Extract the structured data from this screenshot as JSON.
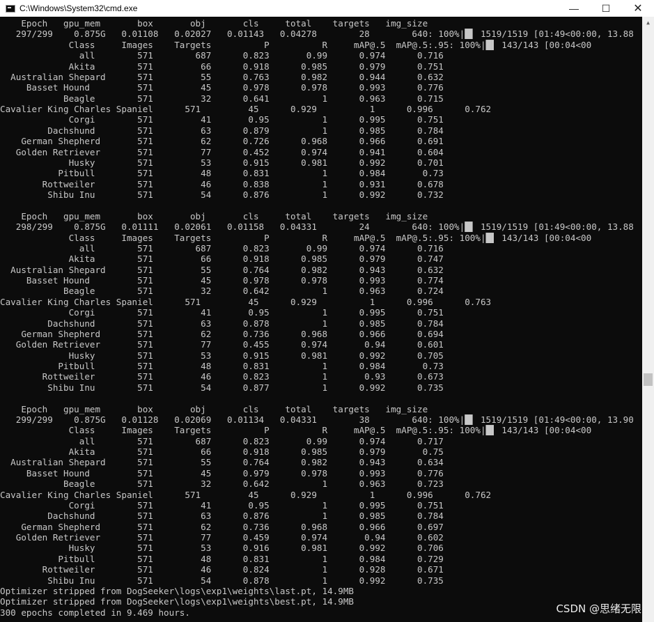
{
  "window": {
    "title": "C:\\Windows\\System32\\cmd.exe",
    "minimize_glyph": "—",
    "maximize_glyph": "☐",
    "close_glyph": "✕",
    "icon": "cmd-console-icon"
  },
  "console": {
    "output": "    Epoch   gpu_mem       box       obj       cls     total    targets   img_size\n   297/299    0.875G   0.01108   0.02027   0.01143   0.04278        28        640: 100%|█▌ 1519/1519 [01:49<00:00, 13.88\n             Class     Images    Targets          P          R     mAP@.5  mAP@.5:.95: 100%|█▌ 143/143 [00:04<00\n               all        571        687      0.823       0.99      0.974      0.716\n             Akita        571         66      0.918      0.985      0.979      0.751\n  Australian Shepard      571         55      0.763      0.982      0.944      0.632\n     Basset Hound         571         45      0.978      0.978      0.993      0.776\n            Beagle        571         32      0.641          1      0.963      0.715\nCavalier King Charles Spaniel      571         45      0.929          1      0.996      0.762\n             Corgi        571         41       0.95          1      0.995      0.751\n         Dachshund        571         63      0.879          1      0.985      0.784\n    German Shepherd       571         62      0.726      0.968      0.966      0.691\n   Golden Retriever       571         77      0.452      0.974      0.941      0.604\n             Husky        571         53      0.915      0.981      0.992      0.701\n           Pitbull        571         48      0.831          1      0.984       0.73\n        Rottweiler        571         46      0.838          1      0.931      0.678\n         Shibu Inu        571         54      0.876          1      0.992      0.732\n\n    Epoch   gpu_mem       box       obj       cls     total    targets   img_size\n   298/299    0.875G   0.01111   0.02061   0.01158   0.04331        24        640: 100%|█▌ 1519/1519 [01:49<00:00, 13.88\n             Class     Images    Targets          P          R     mAP@.5  mAP@.5:.95: 100%|█▌ 143/143 [00:04<00\n               all        571        687      0.823       0.99      0.974      0.716\n             Akita        571         66      0.918      0.985      0.979      0.747\n  Australian Shepard      571         55      0.764      0.982      0.943      0.632\n     Basset Hound         571         45      0.978      0.978      0.993      0.774\n            Beagle        571         32      0.642          1      0.963      0.724\nCavalier King Charles Spaniel      571         45      0.929          1      0.996      0.763\n             Corgi        571         41       0.95          1      0.995      0.751\n         Dachshund        571         63      0.878          1      0.985      0.784\n    German Shepherd       571         62      0.736      0.968      0.966      0.694\n   Golden Retriever       571         77      0.455      0.974       0.94      0.601\n             Husky        571         53      0.915      0.981      0.992      0.705\n           Pitbull        571         48      0.831          1      0.984       0.73\n        Rottweiler        571         46      0.823          1       0.93      0.673\n         Shibu Inu        571         54      0.877          1      0.992      0.735\n\n    Epoch   gpu_mem       box       obj       cls     total    targets   img_size\n   299/299    0.875G   0.01128   0.02069   0.01134   0.04331        38        640: 100%|█▌ 1519/1519 [01:49<00:00, 13.90\n             Class     Images    Targets          P          R     mAP@.5  mAP@.5:.95: 100%|█▌ 143/143 [00:04<00\n               all        571        687      0.823       0.99      0.974      0.717\n             Akita        571         66      0.918      0.985      0.979       0.75\n  Australian Shepard      571         55      0.764      0.982      0.943      0.634\n     Basset Hound         571         45      0.979      0.978      0.993      0.776\n            Beagle        571         32      0.642          1      0.963      0.723\nCavalier King Charles Spaniel      571         45      0.929          1      0.996      0.762\n             Corgi        571         41       0.95          1      0.995      0.751\n         Dachshund        571         63      0.876          1      0.985      0.784\n    German Shepherd       571         62      0.736      0.968      0.966      0.697\n   Golden Retriever       571         77      0.459      0.974       0.94      0.602\n             Husky        571         53      0.916      0.981      0.992      0.706\n           Pitbull        571         48      0.831          1      0.984      0.729\n        Rottweiler        571         46      0.824          1      0.928      0.671\n         Shibu Inu        571         54      0.878          1      0.992      0.735\nOptimizer stripped from DogSeeker\\logs\\exp1\\weights\\last.pt, 14.9MB\nOptimizer stripped from DogSeeker\\logs\\exp1\\weights\\best.pt, 14.9MB\n300 epochs completed in 9.469 hours."
  },
  "scrollbar": {
    "up_glyph": "▲"
  },
  "watermark": {
    "text": "CSDN @思绪无限"
  },
  "colors": {
    "console_background": "#0c0c0c",
    "console_text": "#c8c8c8",
    "titlebar_background": "#ffffff"
  }
}
